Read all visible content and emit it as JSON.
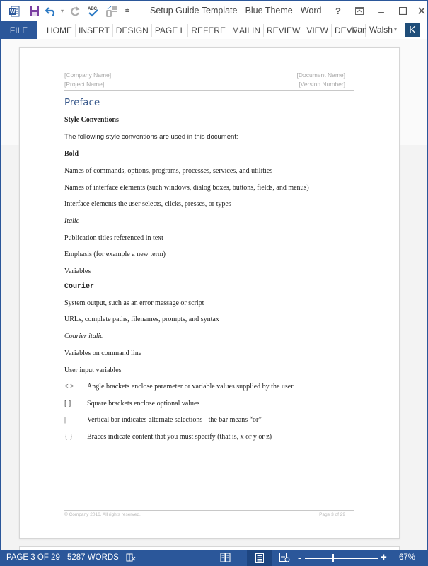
{
  "window": {
    "title": "Setup Guide Template - Blue Theme - Word",
    "controls": {
      "help": "?",
      "minimize": "–",
      "close": "✕"
    }
  },
  "quick_access": {
    "icons": [
      "word-logo-icon",
      "save-icon",
      "undo-icon",
      "redo-icon",
      "spelling-icon",
      "touch-mode-icon",
      "customize-icon"
    ]
  },
  "ribbon": {
    "file_tab": "FILE",
    "tabs": [
      "HOME",
      "INSERT",
      "DESIGN",
      "PAGE L",
      "REFERE",
      "MAILIN",
      "REVIEW",
      "VIEW",
      "DEVEL"
    ],
    "user_name": "Ivan Walsh",
    "user_initial": "K"
  },
  "document": {
    "header": {
      "company": "[Company Name]",
      "project": "[Project Name]",
      "document_name": "[Document Name]",
      "version": "[Version Number]"
    },
    "heading": "Preface",
    "subheading": "Style Conventions",
    "intro": "The following style conventions are used in this document:",
    "sections": [
      {
        "label": "Bold",
        "style": "bold",
        "items": [
          "Names of commands, options, programs, processes, services, and utilities",
          "Names of interface elements (such windows, dialog boxes, buttons, fields, and menus)",
          "Interface elements the user selects, clicks, presses, or types"
        ]
      },
      {
        "label": "Italic",
        "style": "italic",
        "items": [
          "Publication titles referenced in text",
          "Emphasis (for example a new term)",
          "Variables"
        ]
      },
      {
        "label": "Courier",
        "style": "mono",
        "items": [
          "System output, such as an error message or script",
          "URLs, complete paths, filenames, prompts, and syntax"
        ]
      },
      {
        "label": "Courier italic",
        "style": "italic",
        "items": [
          "Variables on command line",
          "User input variables"
        ]
      }
    ],
    "symbols": [
      {
        "symbol": "< >",
        "description": "Angle brackets enclose parameter or variable values supplied by the user"
      },
      {
        "symbol": "[ ]",
        "description": "Square brackets enclose optional values"
      },
      {
        "symbol": "|",
        "description": "Vertical bar indicates alternate selections - the bar means “or”"
      },
      {
        "symbol": "{ }",
        "description": "Braces indicate content that you must specify (that is, x or y or z)"
      }
    ],
    "footer": {
      "copyright": "© Company 2016. All rights reserved.",
      "page": "Page 3 of 29"
    }
  },
  "status_bar": {
    "page": "PAGE 3 OF 29",
    "words": "5287 WORDS",
    "zoom_percent": "67%",
    "zoom_value": 67,
    "active_view": "print-layout"
  },
  "colors": {
    "accent": "#2b579a",
    "heading": "#3a5a8c",
    "avatar": "#1f4e79"
  }
}
